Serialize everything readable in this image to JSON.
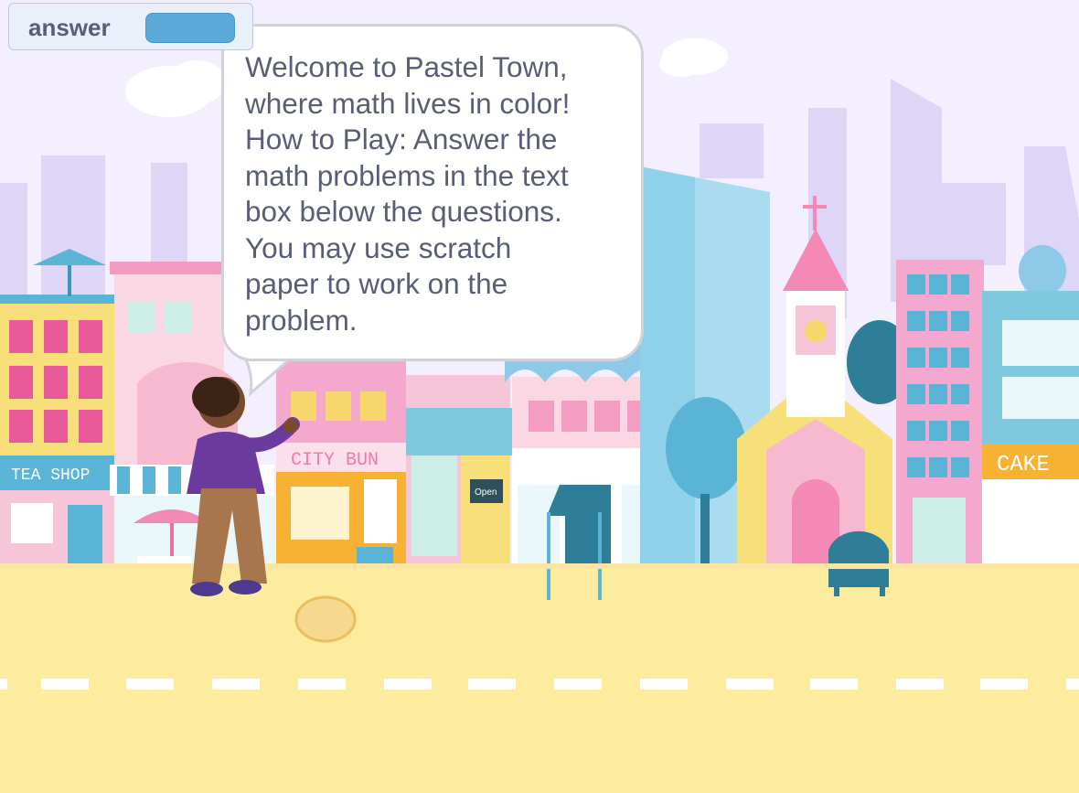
{
  "variable_monitor": {
    "label": "answer",
    "value": ""
  },
  "speech_bubble": {
    "text": "Welcome to Pastel Town,\nwhere math lives in color!\nHow to Play: Answer the\nmath problems in the text\nbox below the questions.\nYou may use scratch\npaper to work on the\nproblem."
  },
  "scene": {
    "signs": {
      "tea_shop": "TEA SHOP",
      "city_bun": "CITY BUN",
      "cake": "CAKE",
      "open": "Open"
    },
    "colors": {
      "sky": "#f4efff",
      "road": "#fdec9d",
      "far_buildings": "#ddd6f7",
      "bubble_text": "#575e75",
      "monitor_value": "#5aa9d9"
    }
  }
}
